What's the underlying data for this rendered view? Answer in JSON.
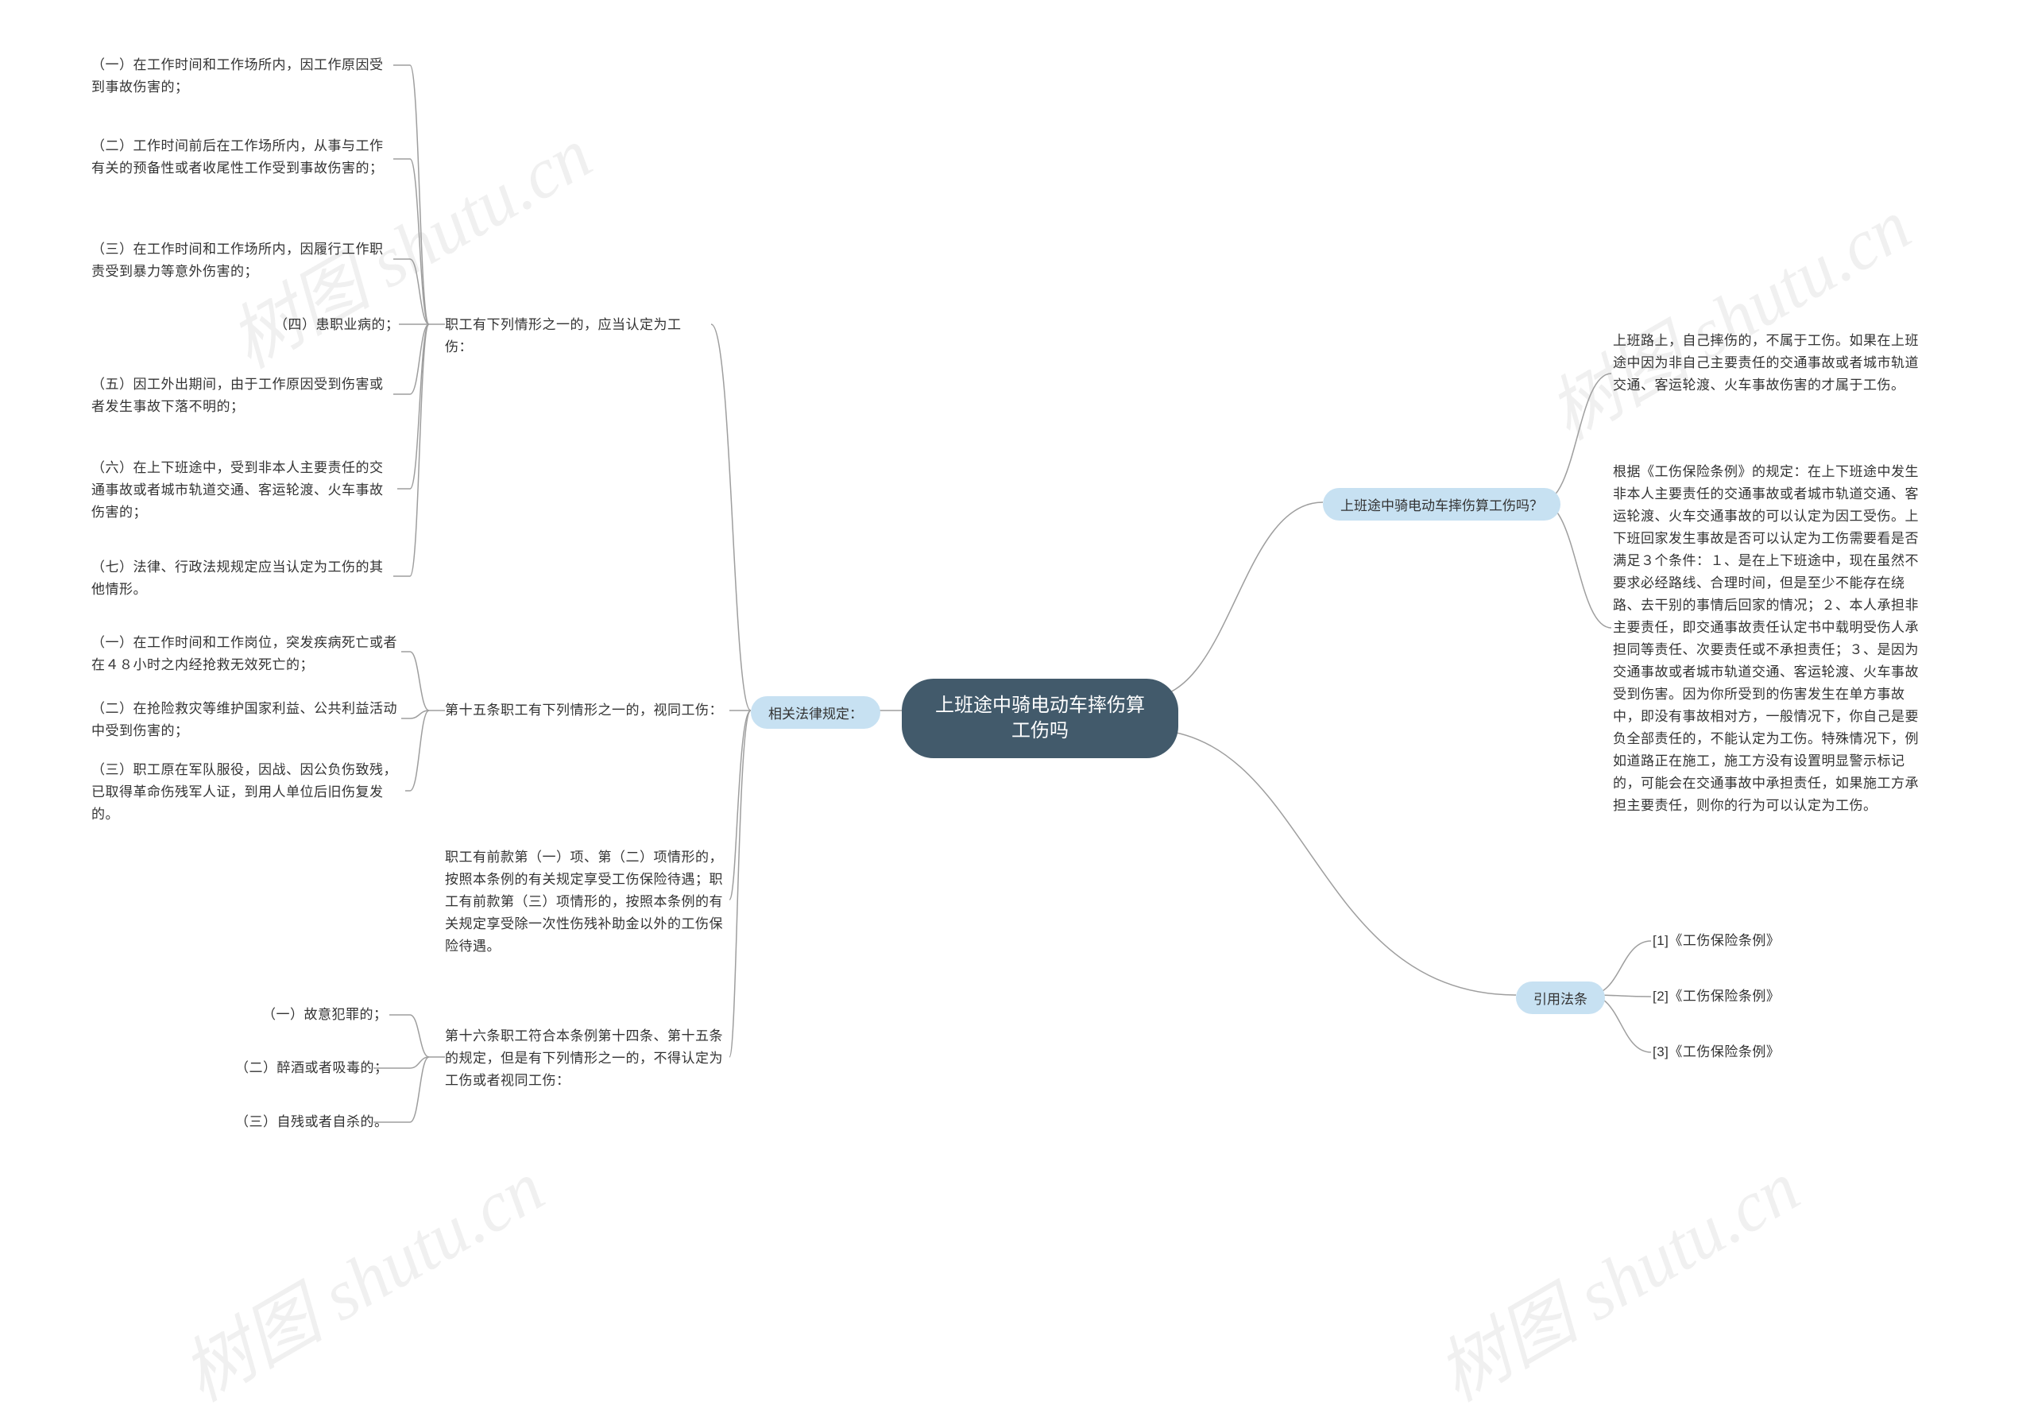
{
  "root": {
    "line1": "上班途中骑电动车摔伤算",
    "line2": "工伤吗"
  },
  "right": {
    "q": {
      "title": "上班途中骑电动车摔伤算工伤吗？",
      "ans1": "上班路上，自己摔伤的，不属于工伤。如果在上班途中因为非自己主要责任的交通事故或者城市轨道交通、客运轮渡、火车事故伤害的才属于工伤。",
      "ans2": "根据《工伤保险条例》的规定：在上下班途中发生非本人主要责任的交通事故或者城市轨道交通、客运轮渡、火车交通事故的可以认定为因工受伤。上下班回家发生事故是否可以认定为工伤需要看是否满足３个条件：１、是在上下班途中，现在虽然不要求必经路线、合理时间，但是至少不能存在绕路、去干别的事情后回家的情况；２、本人承担非主要责任，即交通事故责任认定书中载明受伤人承担同等责任、次要责任或不承担责任；３、是因为交通事故或者城市轨道交通、客运轮渡、火车事故受到伤害。因为你所受到的伤害发生在单方事故中，即没有事故相对方，一般情况下，你自己是要负全部责任的，不能认定为工伤。特殊情况下，例如道路正在施工，施工方没有设置明显警示标记的，可能会在交通事故中承担责任，如果施工方承担主要责任，则你的行为可以认定为工伤。"
    },
    "ref": {
      "title": "引用法条",
      "items": [
        "[1]《工伤保险条例》",
        "[2]《工伤保险条例》",
        "[3]《工伤保险条例》"
      ]
    }
  },
  "left": {
    "law": {
      "title": "相关法律规定：",
      "art14": {
        "intro": "职工有下列情形之一的，应当认定为工伤：",
        "items": [
          "（一）在工作时间和工作场所内，因工作原因受到事故伤害的；",
          "（二）工作时间前后在工作场所内，从事与工作有关的预备性或者收尾性工作受到事故伤害的；",
          "（三）在工作时间和工作场所内，因履行工作职责受到暴力等意外伤害的；",
          "（四）患职业病的；",
          "（五）因工外出期间，由于工作原因受到伤害或者发生事故下落不明的；",
          "（六）在上下班途中，受到非本人主要责任的交通事故或者城市轨道交通、客运轮渡、火车事故伤害的；",
          "（七）法律、行政法规规定应当认定为工伤的其他情形。"
        ]
      },
      "art15": {
        "intro": "第十五条职工有下列情形之一的，视同工伤：",
        "items": [
          "（一）在工作时间和工作岗位，突发疾病死亡或者在４８小时之内经抢救无效死亡的；",
          "（二）在抢险救灾等维护国家利益、公共利益活动中受到伤害的；",
          "（三）职工原在军队服役，因战、因公负伤致残，已取得革命伤残军人证，到用人单位后旧伤复发的。"
        ],
        "extra": "职工有前款第（一）项、第（二）项情形的，按照本条例的有关规定享受工伤保险待遇；职工有前款第（三）项情形的，按照本条例的有关规定享受除一次性伤残补助金以外的工伤保险待遇。"
      },
      "art16": {
        "intro": "第十六条职工符合本条例第十四条、第十五条的规定，但是有下列情形之一的，不得认定为工伤或者视同工伤：",
        "items": [
          "（一）故意犯罪的；",
          "（二）醉酒或者吸毒的；",
          "（三）自残或者自杀的。"
        ]
      }
    }
  },
  "watermark": "树图 shutu.cn"
}
